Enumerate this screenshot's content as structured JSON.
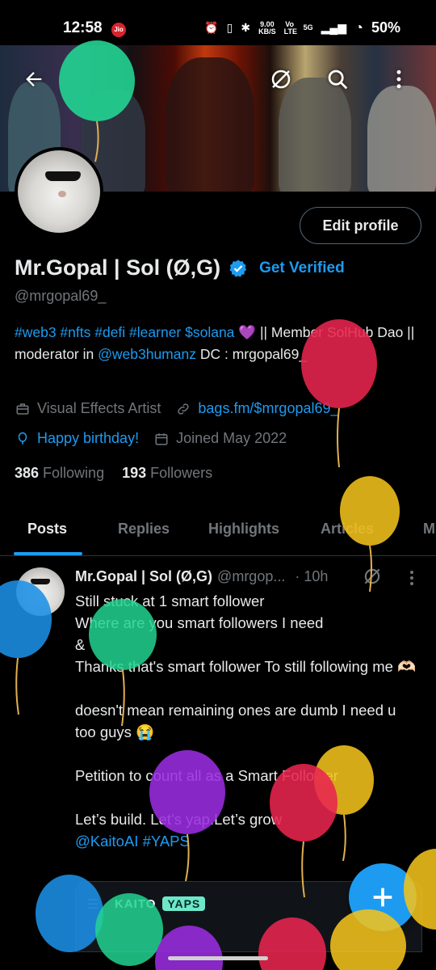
{
  "status_bar": {
    "time": "12:58",
    "carrier_badge": "Jio",
    "net_speed": "9.00",
    "net_speed_unit": "KB/S",
    "volte": "Vo LTE",
    "network": "5G",
    "battery": "50%"
  },
  "header": {
    "back_icon": "arrow-left-icon",
    "grok_icon": "grok-slash-icon",
    "search_icon": "search-icon",
    "more_icon": "more-vertical-icon"
  },
  "profile": {
    "edit_button": "Edit profile",
    "name": "Mr.Gopal | Sol (Ø,G)",
    "get_verified": "Get Verified",
    "handle": "@mrgopal69_",
    "bio_parts": {
      "tags": "#web3 #nfts #defi #learner $solana",
      "heart": "💜",
      "text1": " || Member SolHub Dao || moderator in ",
      "mention": "@web3humanz",
      "text2": " DC : mrgopal69_"
    },
    "profession": "Visual Effects Artist",
    "website": "bags.fm/$mrgopal69_",
    "birthday": "Happy birthday!",
    "joined": "Joined May 2022",
    "following_count": "386",
    "following_label": "Following",
    "followers_count": "193",
    "followers_label": "Followers"
  },
  "tabs": [
    {
      "label": "Posts",
      "active": true
    },
    {
      "label": "Replies"
    },
    {
      "label": "Highlights"
    },
    {
      "label": "Articles"
    },
    {
      "label": "M"
    }
  ],
  "post": {
    "name": "Mr.Gopal | Sol (Ø,G)",
    "handle": "@mrgop...",
    "time": "· 10h",
    "lines": {
      "l1": "Still stuck at 1 smart follower",
      "l2": "Where are you smart followers I need",
      "l3": "&",
      "l4": "Thanks that's smart follower To still following me 🫶🏻",
      "l5": "doesn't mean remaining ones are dumb I need u too guys 😭",
      "l6": "Petition to count all as a Smart Follower",
      "l7": "Let’s build. Let’s yap.Let’s grow",
      "mention": "@KaitoAI",
      "hashtag": "#YAPS"
    },
    "card": {
      "brand": "KAITO",
      "badge": "YAPS"
    }
  },
  "fab": {
    "icon": "plus-icon"
  },
  "colors": {
    "accent": "#1d9bf0",
    "text": "#e7e9ea",
    "muted": "#71767b",
    "background": "#000000"
  }
}
